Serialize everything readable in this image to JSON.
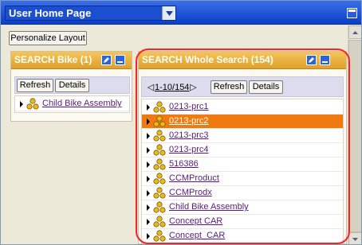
{
  "window": {
    "page_select_value": "User Home Page",
    "icons": {
      "dropdown": "chevron-down-icon",
      "window": "window-icon"
    }
  },
  "toolbar": {
    "personalize_label": "Personalize Layout"
  },
  "portlets": [
    {
      "title": "SEARCH Bike (1)",
      "buttons": {
        "refresh": "Refresh",
        "details": "Details"
      },
      "items": [
        {
          "label": "Child Bike Assembly",
          "selected": false
        }
      ]
    },
    {
      "title": "SEARCH Whole Search (154)",
      "pager": {
        "range": "1-10/154"
      },
      "buttons": {
        "refresh": "Refresh",
        "details": "Details"
      },
      "items": [
        {
          "label": "0213-prc1",
          "selected": false
        },
        {
          "label": "0213-prc2",
          "selected": true
        },
        {
          "label": "0213-prc3",
          "selected": false
        },
        {
          "label": "0213-prc4",
          "selected": false
        },
        {
          "label": "516386",
          "selected": false
        },
        {
          "label": "CCMProduct",
          "selected": false
        },
        {
          "label": "CCMProdx",
          "selected": false
        },
        {
          "label": "Child Bike Assembly",
          "selected": false
        },
        {
          "label": "Concept CAR",
          "selected": false
        },
        {
          "label": "Concept_CAR",
          "selected": false
        }
      ]
    }
  ],
  "colors": {
    "header_orange": "#e8a83a",
    "selected_row": "#f07a10",
    "title_blue": "#0a3fc8",
    "highlight_red": "#ff2020"
  }
}
